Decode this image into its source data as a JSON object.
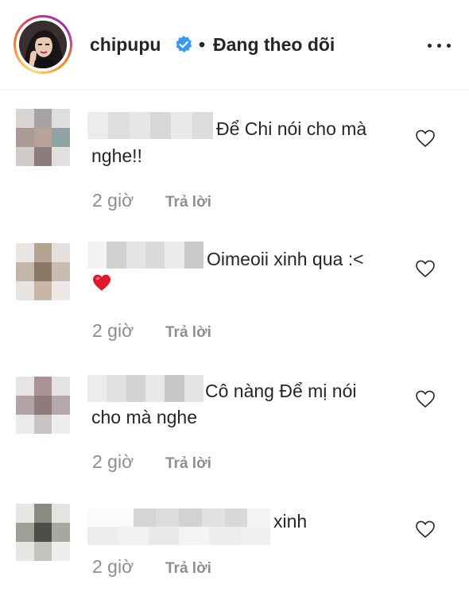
{
  "header": {
    "username": "chipupu",
    "separator": "•",
    "follow_status": "Đang theo dõi"
  },
  "comments": [
    {
      "text_line1": "Để Chi nói cho mà",
      "text_line2": "nghe!!",
      "time": "2 giờ",
      "reply_label": "Trả lời"
    },
    {
      "text_line1": "Oimeoii xinh qua :<",
      "text_line2": "",
      "emoji": "heart-emoji",
      "time": "2 giờ",
      "reply_label": "Trả lời"
    },
    {
      "text_line1": "Cô nàng Để mị nói",
      "text_line2": "cho mà nghe",
      "time": "2 giờ",
      "reply_label": "Trả lời"
    },
    {
      "text_line1": "xinh",
      "text_line2": "",
      "time": "2 giờ",
      "reply_label": "Trả lời"
    }
  ],
  "colors": {
    "text": "#262626",
    "muted": "#8e8e8e",
    "verified_blue": "#3897f0",
    "emoji_red": "#e0192d"
  },
  "icons": [
    "verified-badge-icon",
    "more-options-icon",
    "heart-outline-icon",
    "red-heart-emoji"
  ]
}
